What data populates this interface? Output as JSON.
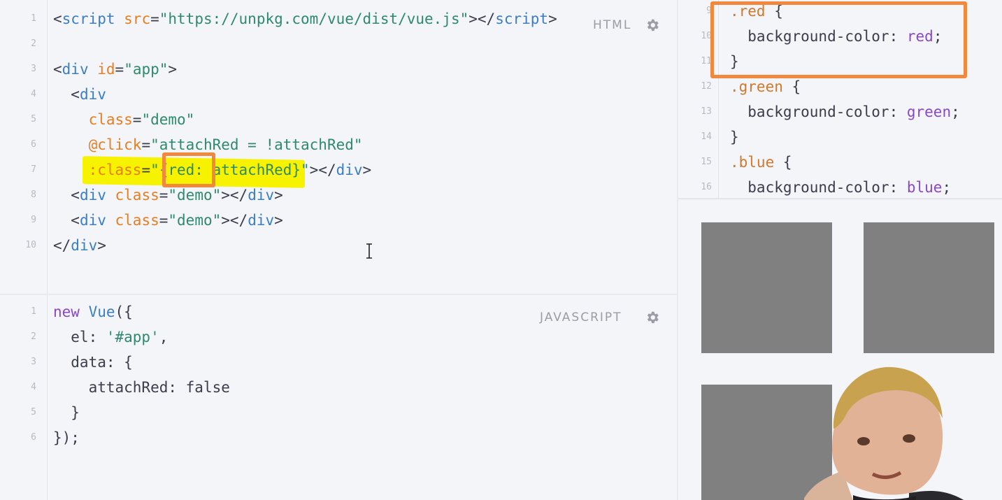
{
  "html_pane": {
    "label": "HTML",
    "lines": [
      {
        "n": "1",
        "tokens": [
          {
            "t": "<",
            "c": "tok-pun"
          },
          {
            "t": "script",
            "c": "tok-tag"
          },
          {
            "t": " src",
            "c": "tok-attr"
          },
          {
            "t": "=",
            "c": "tok-pun"
          },
          {
            "t": "\"https://unpkg.com/vue/dist/vue.js\"",
            "c": "tok-str"
          },
          {
            "t": "></",
            "c": "tok-pun"
          },
          {
            "t": "script",
            "c": "tok-tag"
          },
          {
            "t": ">",
            "c": "tok-pun"
          }
        ]
      },
      {
        "n": "2",
        "tokens": []
      },
      {
        "n": "3",
        "tokens": [
          {
            "t": "<",
            "c": "tok-pun"
          },
          {
            "t": "div",
            "c": "tok-tag"
          },
          {
            "t": " id",
            "c": "tok-attr"
          },
          {
            "t": "=",
            "c": "tok-pun"
          },
          {
            "t": "\"app\"",
            "c": "tok-str"
          },
          {
            "t": ">",
            "c": "tok-pun"
          }
        ]
      },
      {
        "n": "4",
        "tokens": [
          {
            "t": "  <",
            "c": "tok-pun"
          },
          {
            "t": "div",
            "c": "tok-tag"
          }
        ]
      },
      {
        "n": "5",
        "tokens": [
          {
            "t": "    class",
            "c": "tok-attr"
          },
          {
            "t": "=",
            "c": "tok-pun"
          },
          {
            "t": "\"demo\"",
            "c": "tok-str"
          }
        ]
      },
      {
        "n": "6",
        "tokens": [
          {
            "t": "    @click",
            "c": "tok-attr"
          },
          {
            "t": "=",
            "c": "tok-pun"
          },
          {
            "t": "\"attachRed = !attachRed\"",
            "c": "tok-str"
          }
        ]
      },
      {
        "n": "7",
        "tokens": [
          {
            "t": "    :class",
            "c": "tok-attr"
          },
          {
            "t": "=",
            "c": "tok-pun"
          },
          {
            "t": "\"{red: attachRed}\"",
            "c": "tok-str"
          },
          {
            "t": "></",
            "c": "tok-pun"
          },
          {
            "t": "div",
            "c": "tok-tag"
          },
          {
            "t": ">",
            "c": "tok-pun"
          }
        ]
      },
      {
        "n": "8",
        "tokens": [
          {
            "t": "  <",
            "c": "tok-pun"
          },
          {
            "t": "div",
            "c": "tok-tag"
          },
          {
            "t": " class",
            "c": "tok-attr"
          },
          {
            "t": "=",
            "c": "tok-pun"
          },
          {
            "t": "\"demo\"",
            "c": "tok-str"
          },
          {
            "t": "></",
            "c": "tok-pun"
          },
          {
            "t": "div",
            "c": "tok-tag"
          },
          {
            "t": ">",
            "c": "tok-pun"
          }
        ]
      },
      {
        "n": "9",
        "tokens": [
          {
            "t": "  <",
            "c": "tok-pun"
          },
          {
            "t": "div",
            "c": "tok-tag"
          },
          {
            "t": " class",
            "c": "tok-attr"
          },
          {
            "t": "=",
            "c": "tok-pun"
          },
          {
            "t": "\"demo\"",
            "c": "tok-str"
          },
          {
            "t": "></",
            "c": "tok-pun"
          },
          {
            "t": "div",
            "c": "tok-tag"
          },
          {
            "t": ">",
            "c": "tok-pun"
          }
        ]
      },
      {
        "n": "10",
        "tokens": [
          {
            "t": "</",
            "c": "tok-pun"
          },
          {
            "t": "div",
            "c": "tok-tag"
          },
          {
            "t": ">",
            "c": "tok-pun"
          }
        ]
      }
    ]
  },
  "js_pane": {
    "label": "JAVASCRIPT",
    "lines": [
      {
        "n": "1",
        "tokens": [
          {
            "t": "new",
            "c": "tok-kw"
          },
          {
            "t": " ",
            "c": "tok-pun"
          },
          {
            "t": "Vue",
            "c": "tok-fn"
          },
          {
            "t": "({",
            "c": "tok-pun"
          }
        ]
      },
      {
        "n": "2",
        "tokens": [
          {
            "t": "  el: ",
            "c": "tok-prop"
          },
          {
            "t": "'#app'",
            "c": "tok-str"
          },
          {
            "t": ",",
            "c": "tok-pun"
          }
        ]
      },
      {
        "n": "3",
        "tokens": [
          {
            "t": "  data: {",
            "c": "tok-prop"
          }
        ]
      },
      {
        "n": "4",
        "tokens": [
          {
            "t": "    attachRed: ",
            "c": "tok-prop"
          },
          {
            "t": "false",
            "c": "tok-bool"
          }
        ]
      },
      {
        "n": "5",
        "tokens": [
          {
            "t": "  }",
            "c": "tok-pun"
          }
        ]
      },
      {
        "n": "6",
        "tokens": [
          {
            "t": "});",
            "c": "tok-pun"
          }
        ]
      }
    ]
  },
  "css_pane": {
    "lines": [
      {
        "n": "9",
        "tokens": [
          {
            "t": ".red",
            "c": "tok-cls"
          },
          {
            "t": " {",
            "c": "tok-pun"
          }
        ]
      },
      {
        "n": "10",
        "tokens": [
          {
            "t": "  background-color: ",
            "c": "tok-prop"
          },
          {
            "t": "red",
            "c": "tok-val"
          },
          {
            "t": ";",
            "c": "tok-pun"
          }
        ]
      },
      {
        "n": "11",
        "tokens": [
          {
            "t": "}",
            "c": "tok-pun"
          }
        ]
      },
      {
        "n": "12",
        "tokens": [
          {
            "t": ".green",
            "c": "tok-cls"
          },
          {
            "t": " {",
            "c": "tok-pun"
          }
        ]
      },
      {
        "n": "13",
        "tokens": [
          {
            "t": "  background-color: ",
            "c": "tok-prop"
          },
          {
            "t": "green",
            "c": "tok-val"
          },
          {
            "t": ";",
            "c": "tok-pun"
          }
        ]
      },
      {
        "n": "14",
        "tokens": [
          {
            "t": "}",
            "c": "tok-pun"
          }
        ]
      },
      {
        "n": "15",
        "tokens": [
          {
            "t": ".blue",
            "c": "tok-cls"
          },
          {
            "t": " {",
            "c": "tok-pun"
          }
        ]
      },
      {
        "n": "16",
        "tokens": [
          {
            "t": "  background-color: ",
            "c": "tok-prop"
          },
          {
            "t": "blue",
            "c": "tok-val"
          },
          {
            "t": ";",
            "c": "tok-pun"
          }
        ]
      }
    ]
  },
  "preview": {
    "box_color": "#808080",
    "box_count": 3
  },
  "icons": {
    "settings": "gear-icon",
    "text_cursor": "ibeam-cursor-icon"
  },
  "colors": {
    "highlight": "#f7f200",
    "annotation": "#f0883e"
  }
}
